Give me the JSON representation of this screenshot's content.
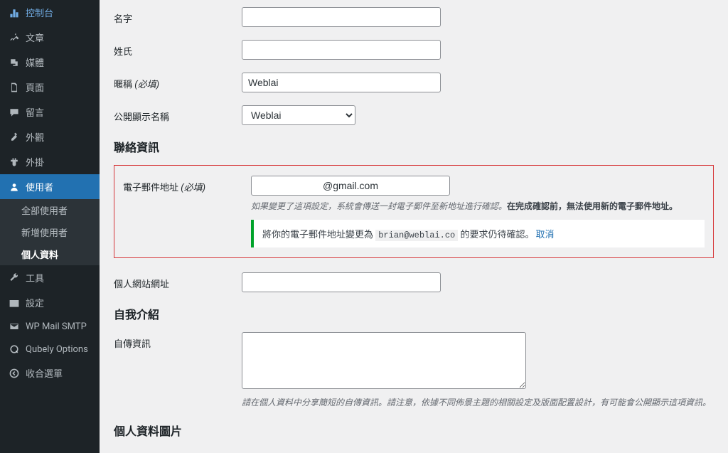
{
  "sidebar": {
    "items": [
      {
        "icon": "dashboard",
        "label": "控制台"
      },
      {
        "icon": "pin",
        "label": "文章"
      },
      {
        "icon": "media",
        "label": "媒體"
      },
      {
        "icon": "page",
        "label": "頁面"
      },
      {
        "icon": "comment",
        "label": "留言"
      },
      {
        "icon": "appearance",
        "label": "外觀"
      },
      {
        "icon": "plugin",
        "label": "外掛"
      },
      {
        "icon": "user",
        "label": "使用者",
        "active": true
      },
      {
        "icon": "tool",
        "label": "工具"
      },
      {
        "icon": "settings",
        "label": "設定"
      },
      {
        "icon": "mail",
        "label": "WP Mail SMTP"
      },
      {
        "icon": "qubely",
        "label": "Qubely Options"
      },
      {
        "icon": "collapse",
        "label": "收合選單"
      }
    ],
    "submenu": [
      {
        "label": "全部使用者"
      },
      {
        "label": "新增使用者"
      },
      {
        "label": "個人資料",
        "active": true
      }
    ]
  },
  "form": {
    "first_name": {
      "label": "名字",
      "value": ""
    },
    "last_name": {
      "label": "姓氏",
      "value": ""
    },
    "nickname": {
      "label": "暱稱",
      "req": "(必填)",
      "value": "Weblai"
    },
    "display_name": {
      "label": "公開顯示名稱",
      "value": "Weblai"
    },
    "section_contact": "聯絡資訊",
    "email": {
      "label": "電子郵件地址",
      "req": "(必填)",
      "value": "@gmail.com",
      "desc_prefix": "如果變更了這項設定，系統會傳送一封電子郵件至新地址進行確認。",
      "desc_bold": "在完成確認前，無法使用新的電子郵件地址。",
      "notice_prefix": "將你的電子郵件地址變更為 ",
      "notice_code": "brian@weblai.co",
      "notice_suffix": " 的要求仍待確認。",
      "notice_cancel": "取消"
    },
    "website": {
      "label": "個人網站網址",
      "value": ""
    },
    "section_about": "自我介紹",
    "bio": {
      "label": "自傳資訊",
      "value": "",
      "desc": "請在個人資料中分享簡短的自傳資訊。請注意，依據不同佈景主題的相關設定及版面配置設計，有可能會公開顯示這項資訊。"
    },
    "section_picture": "個人資料圖片"
  }
}
